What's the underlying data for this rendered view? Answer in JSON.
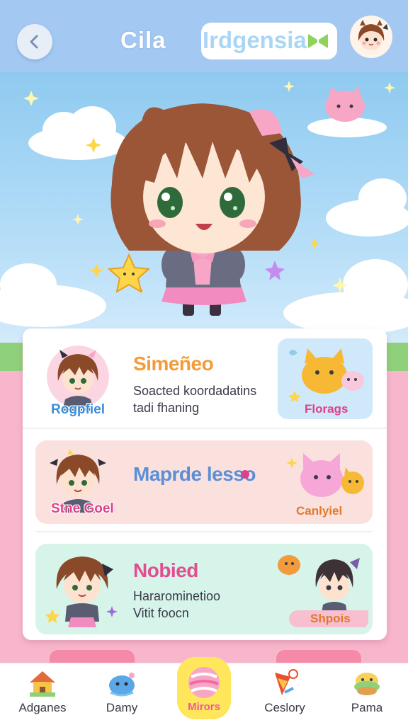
{
  "header": {
    "title": "Cila",
    "title_field": "Irdgensia",
    "back_icon": "chevron-left-icon",
    "field_icon": "leaf-icon"
  },
  "items": [
    {
      "avatar_label": "Rogpfiel",
      "title": "Simeñeo",
      "desc_line1": "Soacted koordadatins",
      "desc_line2": "tadi fhaning",
      "thumb_label": "Florags",
      "title_color": "#f39b3a",
      "label_color": "#3a8fd9",
      "thumb_label_color": "#e0408a"
    },
    {
      "avatar_label": "Stne Goel",
      "title": "Maprde lesso",
      "thumb_label": "Canlyiel",
      "title_color": "#5b8fd6",
      "label_color": "#e0408a",
      "thumb_label_color": "#e07a2a"
    },
    {
      "avatar_label": "",
      "title": "Nobied",
      "desc_line1": "Hararominetioo",
      "desc_line2": "Vitit foocn",
      "thumb_label": "Shpois",
      "title_color": "#e34d8f",
      "thumb_label_color": "#e07a2a"
    }
  ],
  "nav": [
    {
      "label": "Adganes",
      "icon": "house-icon"
    },
    {
      "label": "Damy",
      "icon": "blue-blob-icon"
    },
    {
      "label": "Mirors",
      "icon": "pink-ball-icon",
      "active": true
    },
    {
      "label": "Ceslory",
      "icon": "paint-icon"
    },
    {
      "label": "Pama",
      "icon": "green-cake-icon"
    }
  ],
  "colors": {
    "header": "#a3c9f2",
    "sky": "#8fcaf0",
    "background": "#f7b6cc",
    "active_tab": "#ffe65a"
  }
}
